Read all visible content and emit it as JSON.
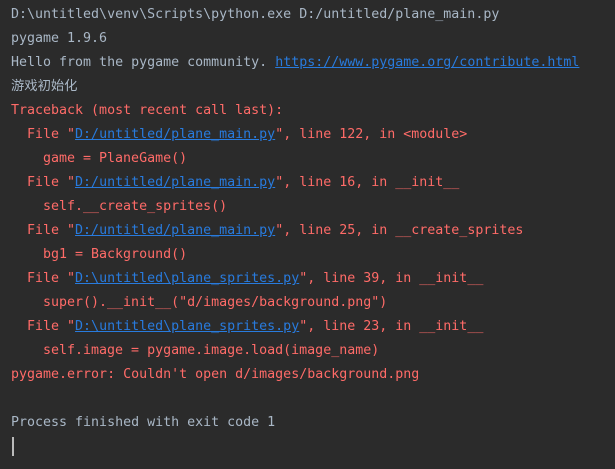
{
  "console": {
    "command": "D:\\untitled\\venv\\Scripts\\python.exe D:/untitled/plane_main.py",
    "pygame_version": "pygame 1.9.6",
    "hello_text": "Hello from the pygame community. ",
    "hello_link": "https://www.pygame.org/contribute.html",
    "init_text": "游戏初始化",
    "traceback_header": "Traceback (most recent call last):",
    "frames": [
      {
        "prefix": "File \"",
        "path": "D:/untitled/plane_main.py",
        "suffix": "\", line 122, in <module>",
        "code": "game = PlaneGame()"
      },
      {
        "prefix": "File \"",
        "path": "D:/untitled/plane_main.py",
        "suffix": "\", line 16, in __init__",
        "code": "self.__create_sprites()"
      },
      {
        "prefix": "File \"",
        "path": "D:/untitled/plane_main.py",
        "suffix": "\", line 25, in __create_sprites",
        "code": "bg1 = Background()"
      },
      {
        "prefix": "File \"",
        "path": "D:\\untitled\\plane_sprites.py",
        "suffix": "\", line 39, in __init__",
        "code": "super().__init__(\"d/images/background.png\")"
      },
      {
        "prefix": "File \"",
        "path": "D:\\untitled\\plane_sprites.py",
        "suffix": "\", line 23, in __init__",
        "code": "self.image = pygame.image.load(image_name)"
      }
    ],
    "error_line": "pygame.error: Couldn't open d/images/background.png",
    "exit_message": "Process finished with exit code 1"
  }
}
